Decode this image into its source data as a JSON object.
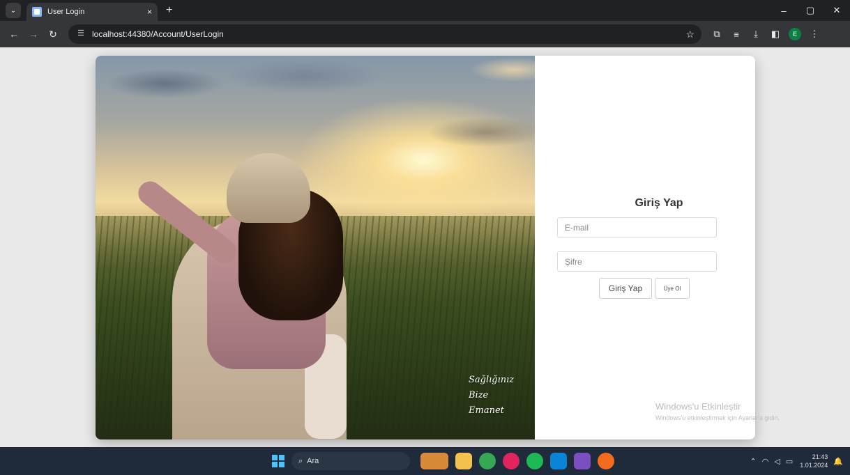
{
  "browser": {
    "tab_title": "User Login",
    "tab_close": "×",
    "new_tab": "+",
    "url": "localhost:44380/Account/UserLogin",
    "profile_initial": "E"
  },
  "window_controls": {
    "minimize": "–",
    "maximize": "▢",
    "close": "✕"
  },
  "page": {
    "slogan": [
      "Sağlığınız",
      "Bize",
      "Emanet"
    ],
    "login": {
      "title": "Giriş Yap",
      "email_placeholder": "E-mail",
      "password_placeholder": "Şifre",
      "login_button": "Giriş Yap",
      "register_button": "Üye Ol"
    }
  },
  "watermark": {
    "line1": "Windows'u Etkinleştir",
    "line2": "Windows'u etkinleştirmek için Ayarlar'a gidin."
  },
  "taskbar": {
    "search_label": "Ara",
    "time": "21:43",
    "date": "1.01.2024"
  },
  "colors": {
    "accent": "#4cc2ff",
    "card_bg": "#ffffff",
    "page_bg": "#e9e9e9"
  }
}
